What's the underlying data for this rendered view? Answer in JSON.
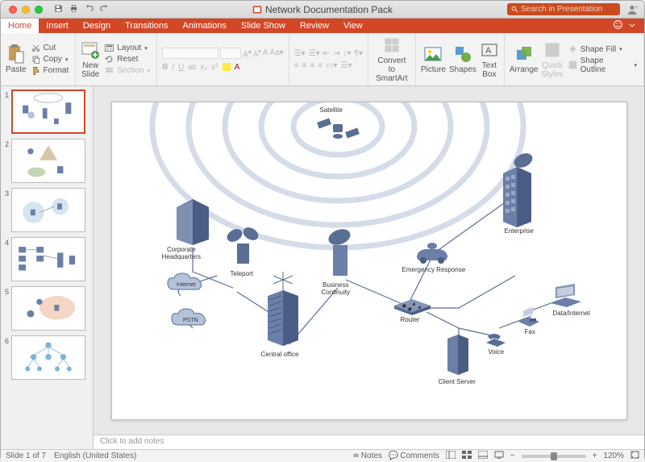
{
  "titlebar": {
    "doc_title": "Network Documentation Pack",
    "search_placeholder": "Search in Presentation"
  },
  "tabs": [
    "Home",
    "Insert",
    "Design",
    "Transitions",
    "Animations",
    "Slide Show",
    "Review",
    "View"
  ],
  "active_tab": "Home",
  "ribbon": {
    "paste": "Paste",
    "cut": "Cut",
    "copy": "Copy",
    "format": "Format",
    "new_slide": "New\nSlide",
    "layout": "Layout",
    "reset": "Reset",
    "section": "Section",
    "bold": "B",
    "italic": "I",
    "underline": "U",
    "convert": "Convert to\nSmartArt",
    "picture": "Picture",
    "shapes": "Shapes",
    "textbox": "Text\nBox",
    "arrange": "Arrange",
    "quick_styles": "Quick\nStyles",
    "shape_fill": "Shape Fill",
    "shape_outline": "Shape Outline"
  },
  "slides": {
    "count": 7,
    "current": 1,
    "numbers": [
      "1",
      "2",
      "3",
      "4",
      "5",
      "6"
    ]
  },
  "notes_placeholder": "Click to add notes",
  "statusbar": {
    "slide_info": "Slide 1 of 7",
    "language": "English (United States)",
    "notes_btn": "Notes",
    "comments_btn": "Comments",
    "zoom": "120%"
  },
  "diagram": {
    "labels": {
      "satellite": "Satellite",
      "corporate_hq": "Corporate\nHeadquarters",
      "teleport": "Teleport",
      "internet": "Internet",
      "pstn": "PSTN",
      "central_office": "Central office",
      "business_continuity": "Business\nContinuity",
      "router": "Router",
      "emergency_response": "Emergency Response",
      "enterprise": "Enterprise",
      "client_server": "Client Server",
      "voice": "Voice",
      "fax": "Fax",
      "data_internet": "Data/Internet"
    }
  }
}
